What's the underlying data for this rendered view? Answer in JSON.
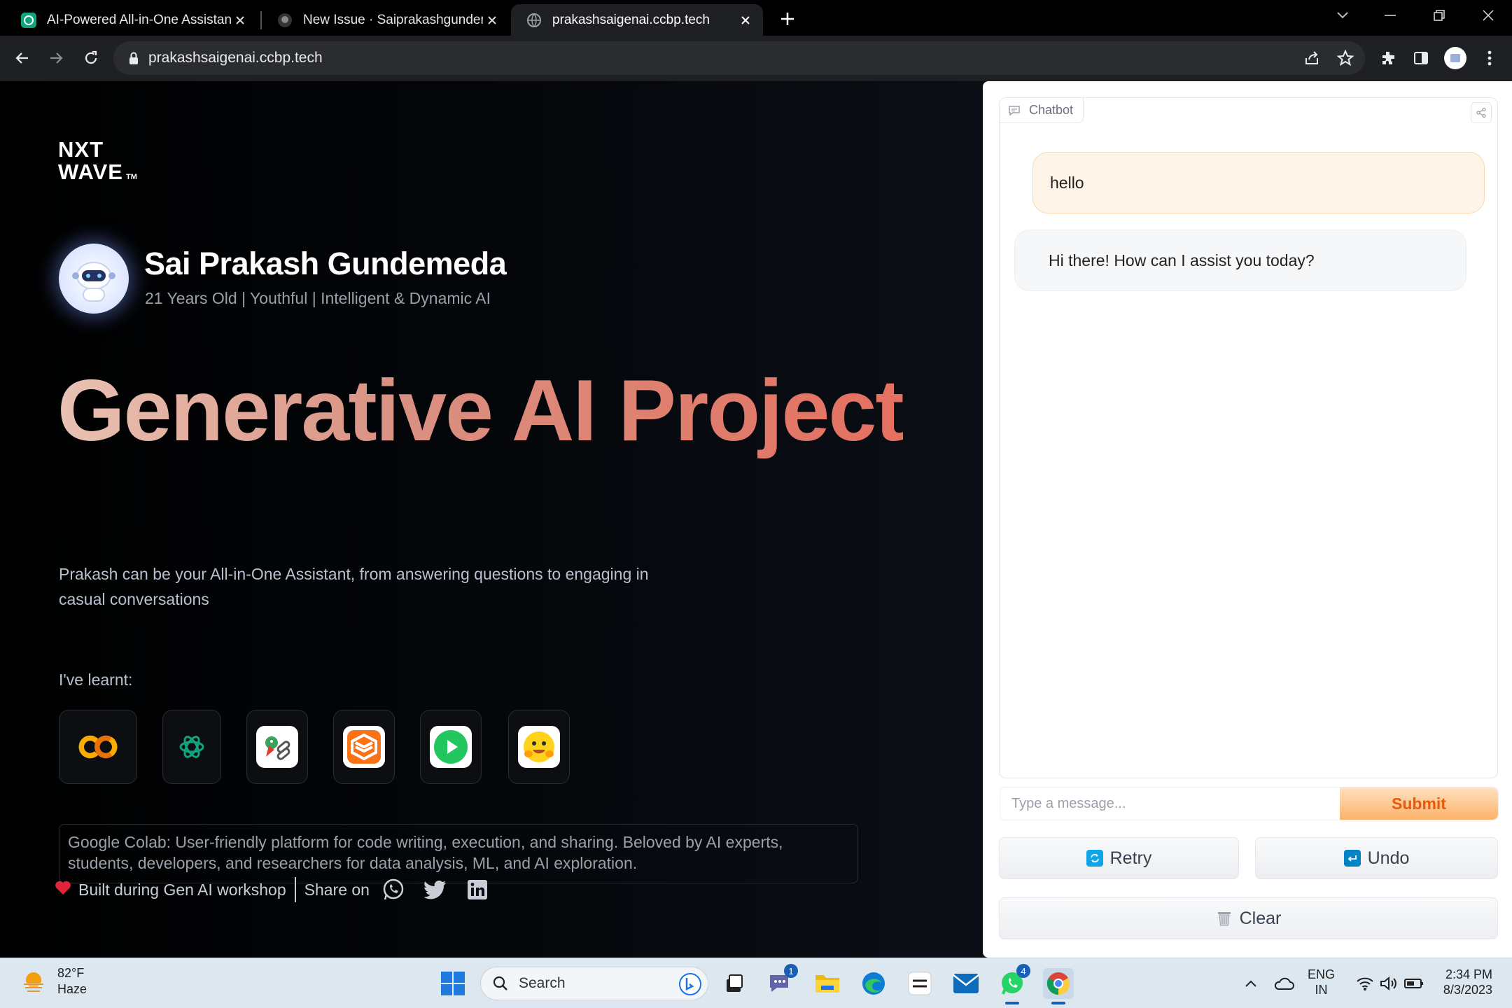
{
  "browser": {
    "tabs": [
      {
        "title": "AI-Powered All-in-One Assistant",
        "active": false
      },
      {
        "title": "New Issue · Saiprakashgundemeda",
        "active": false
      },
      {
        "title": "prakashsaigenai.ccbp.tech",
        "active": true
      }
    ],
    "url": "prakashsaigenai.ccbp.tech"
  },
  "page": {
    "logo_line1": "NXT",
    "logo_line2": "WAVE",
    "logo_tm": "TM",
    "profile": {
      "name": "Sai Prakash Gundemeda",
      "subtitle": "21 Years Old | Youthful | Intelligent & Dynamic AI"
    },
    "headline": "Generative AI Project",
    "description": "Prakash can be your All-in-One Assistant, from answering questions to engaging in casual conversations",
    "learnt_label": "I've learnt:",
    "tools": [
      {
        "icon": "google-colab-icon"
      },
      {
        "icon": "openai-icon"
      },
      {
        "icon": "langchain-icon"
      },
      {
        "icon": "gradio-icon"
      },
      {
        "icon": "play-icon"
      },
      {
        "icon": "hugging-face-icon"
      }
    ],
    "info_text": "Google Colab: User-friendly platform for code writing, execution, and sharing. Beloved by AI experts, students, developers, and researchers for data analysis, ML, and AI exploration.",
    "footer": {
      "built": "Built during Gen AI workshop",
      "share": "Share on"
    }
  },
  "chat": {
    "label": "Chatbot",
    "messages": [
      {
        "role": "user",
        "text": "hello"
      },
      {
        "role": "bot",
        "text": "Hi there! How can I assist you today?"
      }
    ],
    "input_placeholder": "Type a message...",
    "submit": "Submit",
    "retry": "Retry",
    "undo": "Undo",
    "clear": "Clear"
  },
  "taskbar": {
    "temp": "82°F",
    "condition": "Haze",
    "search": "Search",
    "teams_badge": "1",
    "whatsapp_badge": "4",
    "lang1": "ENG",
    "lang2": "IN",
    "time": "2:34 PM",
    "date": "8/3/2023"
  },
  "colors": {
    "accent_orange": "#ea580c",
    "headline_start": "#e9c2b3",
    "headline_end": "#e47060"
  }
}
